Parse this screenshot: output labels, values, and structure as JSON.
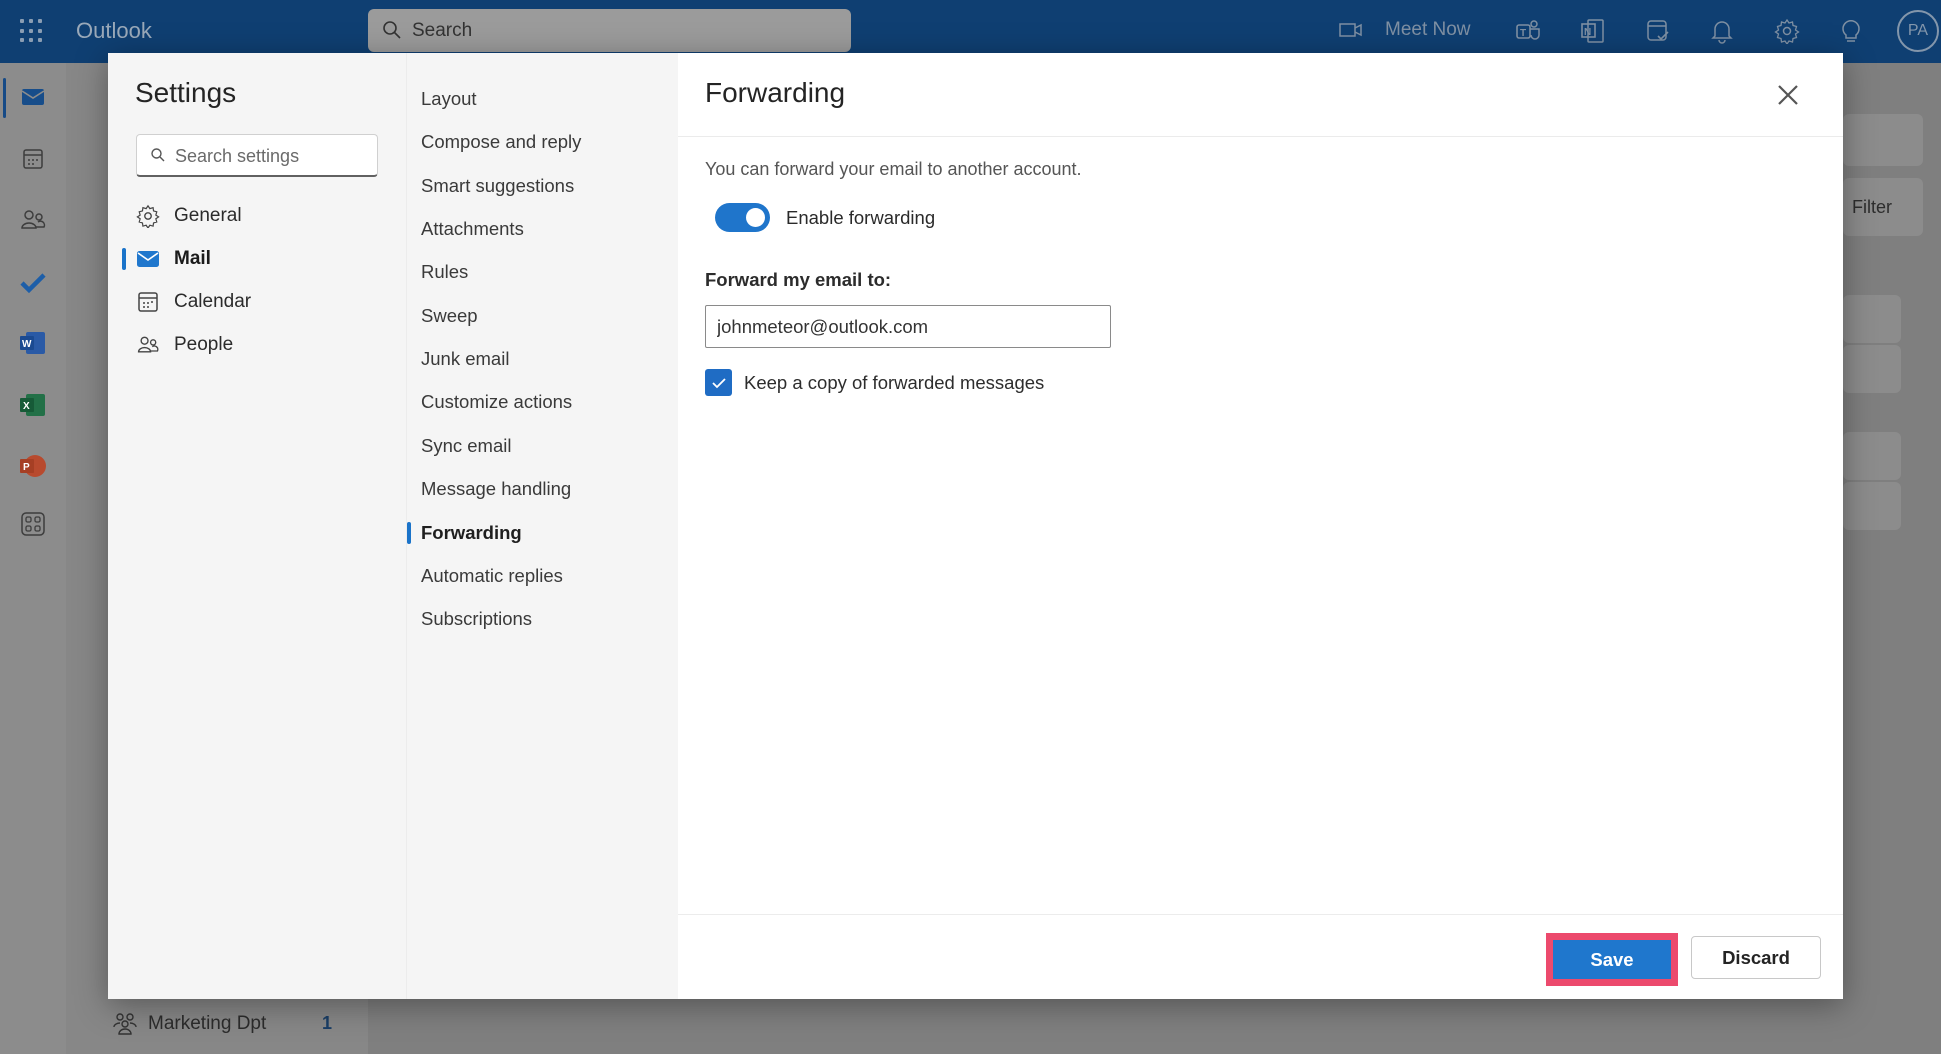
{
  "topbar": {
    "app_name": "Outlook",
    "search_placeholder": "Search",
    "meet_now_label": "Meet Now",
    "avatar_initials": "PA",
    "icons": [
      "app-launcher-icon",
      "video-camera-icon",
      "teams-icon",
      "onenote-icon",
      "my-day-icon",
      "bell-icon",
      "gear-icon",
      "lightbulb-icon"
    ]
  },
  "rail": {
    "icons": [
      "mail-icon",
      "calendar-icon",
      "people-icon",
      "todo-icon",
      "word-icon",
      "excel-icon",
      "powerpoint-icon",
      "more-apps-icon"
    ]
  },
  "background": {
    "filter_label": "Filter",
    "folder_name": "Marketing Dpt",
    "folder_count": "1"
  },
  "settings": {
    "title": "Settings",
    "search_placeholder": "Search settings",
    "categories": [
      {
        "label": "General",
        "icon": "gear-icon",
        "active": false
      },
      {
        "label": "Mail",
        "icon": "mail-icon",
        "active": true
      },
      {
        "label": "Calendar",
        "icon": "calendar-icon",
        "active": false
      },
      {
        "label": "People",
        "icon": "people-icon",
        "active": false
      }
    ],
    "mail_sections": [
      {
        "label": "Layout",
        "active": false
      },
      {
        "label": "Compose and reply",
        "active": false
      },
      {
        "label": "Smart suggestions",
        "active": false
      },
      {
        "label": "Attachments",
        "active": false
      },
      {
        "label": "Rules",
        "active": false
      },
      {
        "label": "Sweep",
        "active": false
      },
      {
        "label": "Junk email",
        "active": false
      },
      {
        "label": "Customize actions",
        "active": false
      },
      {
        "label": "Sync email",
        "active": false
      },
      {
        "label": "Message handling",
        "active": false
      },
      {
        "label": "Forwarding",
        "active": true
      },
      {
        "label": "Automatic replies",
        "active": false
      },
      {
        "label": "Subscriptions",
        "active": false
      }
    ]
  },
  "forwarding": {
    "title": "Forwarding",
    "description": "You can forward your email to another account.",
    "enable_label": "Enable forwarding",
    "enabled": true,
    "forward_to_label": "Forward my email to:",
    "forward_to_value": "johnmeteor@outlook.com",
    "keep_copy_label": "Keep a copy of forwarded messages",
    "keep_copy_checked": true,
    "save_label": "Save",
    "discard_label": "Discard"
  },
  "colors": {
    "topbar": "#0f3f72",
    "accent": "#1f77cd",
    "highlight_frame": "#ec4a6d"
  }
}
